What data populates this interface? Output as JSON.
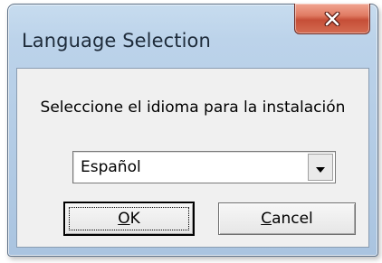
{
  "window": {
    "title": "Language Selection",
    "close_icon": "close-icon"
  },
  "dialog": {
    "prompt": "Seleccione el idioma para la instalación",
    "language_select": {
      "selected": "Español",
      "arrow_icon": "chevron-down-icon"
    },
    "ok_button": {
      "mnemonic": "O",
      "rest": "K"
    },
    "cancel_button": {
      "mnemonic": "C",
      "rest": "ancel"
    }
  },
  "colors": {
    "title_bar": "#bcd3ea",
    "close_button": "#c64e37",
    "client_bg": "#f0f0f0"
  }
}
